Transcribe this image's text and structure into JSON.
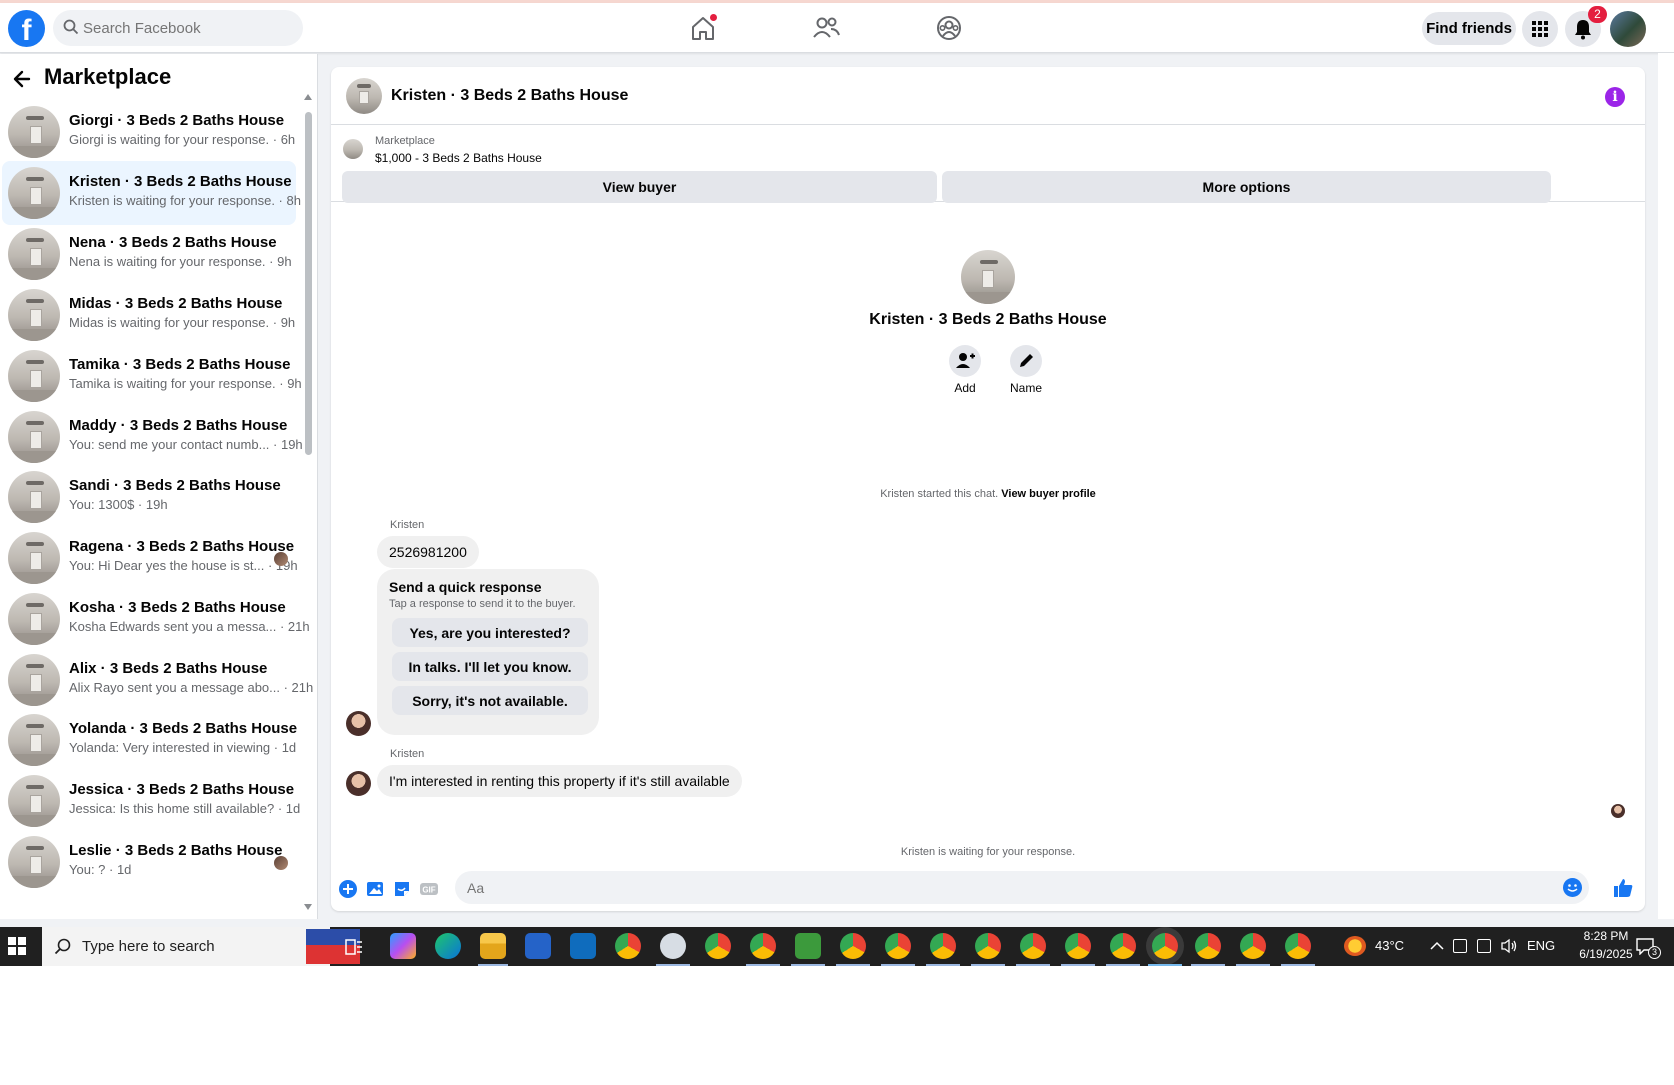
{
  "topbar": {
    "logo": "f",
    "search_placeholder": "Search Facebook",
    "find_friends": "Find friends",
    "notification_count": "2",
    "icons": [
      "home-icon",
      "friends-icon",
      "groups-icon",
      "menu-grid-icon",
      "bell-icon"
    ]
  },
  "sidebar": {
    "title": "Marketplace",
    "conversations": [
      {
        "title": "Giorgi · 3 Beds 2 Baths House",
        "sub": "Giorgi is waiting for your response. · 6h"
      },
      {
        "title": "Kristen · 3 Beds 2 Baths House",
        "sub": "Kristen is waiting for your response. · 8h"
      },
      {
        "title": "Nena · 3 Beds 2 Baths House",
        "sub": "Nena is waiting for your response. · 9h"
      },
      {
        "title": "Midas · 3 Beds 2 Baths House",
        "sub": "Midas is waiting for your response. · 9h"
      },
      {
        "title": "Tamika · 3 Beds 2 Baths House",
        "sub": "Tamika is waiting for your response. · 9h"
      },
      {
        "title": "Maddy · 3 Beds 2 Baths House",
        "sub": "You: send me your contact numb...   · 19h"
      },
      {
        "title": "Sandi · 3 Beds 2 Baths House",
        "sub": "You: 1300$ · 19h"
      },
      {
        "title": "Ragena · 3 Beds 2 Baths House",
        "sub": "You: Hi Dear yes the house is st...  · 19h"
      },
      {
        "title": "Kosha · 3 Beds 2 Baths House",
        "sub": "Kosha Edwards sent you a messa...   · 21h"
      },
      {
        "title": "Alix · 3 Beds 2 Baths House",
        "sub": "Alix Rayo sent you a message abo...  · 21h"
      },
      {
        "title": "Yolanda · 3 Beds 2 Baths House",
        "sub": "Yolanda: Very interested in viewing · 1d"
      },
      {
        "title": "Jessica · 3 Beds 2 Baths House",
        "sub": "Jessica: Is this home still available? · 1d"
      },
      {
        "title": "Leslie · 3 Beds 2 Baths House",
        "sub": "You: ? · 1d"
      }
    ]
  },
  "chat": {
    "header_title": "Kristen · 3 Beds 2 Baths House",
    "listing_label": "Marketplace",
    "listing_price": "$1,000 - 3 Beds 2 Baths House",
    "view_buyer": "View buyer",
    "more_options": "More options",
    "profile_name": "Kristen · 3 Beds 2 Baths House",
    "add_label": "Add",
    "name_label": "Name",
    "started_text": "Kristen started this chat.",
    "view_buyer_profile": "View buyer profile",
    "sender": "Kristen",
    "message_1": "2526981200",
    "quick_title": "Send a quick response",
    "quick_sub": "Tap a response to send it to the buyer.",
    "quick_options": [
      "Yes, are you interested?",
      "In talks. I'll let you know.",
      "Sorry, it's not available."
    ],
    "message_2": "I'm interested in renting this property if it's still available",
    "waiting": "Kristen is waiting for your response.",
    "composer_placeholder": "Aa"
  },
  "taskbar": {
    "search_placeholder": "Type here to search",
    "temperature": "43°C",
    "language": "ENG",
    "time": "8:28 PM",
    "date": "6/19/2025",
    "notification_count": "3"
  }
}
